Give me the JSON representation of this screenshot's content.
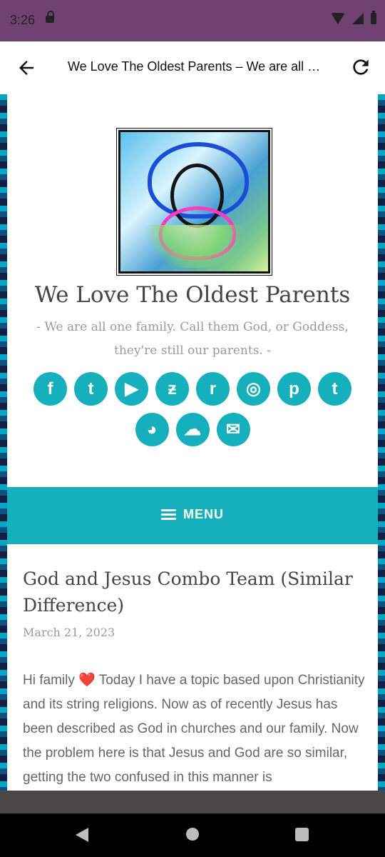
{
  "status": {
    "time": "3:26",
    "icons": [
      "lock-icon",
      "wifi-icon",
      "signal-icon",
      "battery-icon"
    ]
  },
  "appbar": {
    "title": "We Love The Oldest Parents – We are all …",
    "back_icon": "back-arrow-icon",
    "reload_icon": "reload-icon"
  },
  "site": {
    "title": "We Love The Oldest Parents",
    "tagline": "- We are all one family. Call them God, or Goddess, they're still our parents. -",
    "accent": "#16b0bc",
    "social": [
      {
        "name": "facebook",
        "glyph": "f"
      },
      {
        "name": "twitter",
        "glyph": "t"
      },
      {
        "name": "youtube",
        "glyph": "▶"
      },
      {
        "name": "deviantart",
        "glyph": "ƶ"
      },
      {
        "name": "reddit",
        "glyph": "r"
      },
      {
        "name": "instagram",
        "glyph": "◎"
      },
      {
        "name": "pinterest",
        "glyph": "p"
      },
      {
        "name": "tumblr",
        "glyph": "t"
      },
      {
        "name": "discord",
        "glyph": "◕"
      },
      {
        "name": "soundcloud",
        "glyph": "☁"
      },
      {
        "name": "email",
        "glyph": "✉"
      }
    ]
  },
  "menu": {
    "label": "MENU"
  },
  "post": {
    "title": "God and Jesus Combo Team (Similar Difference)",
    "date": "March 21, 2023",
    "body": "Hi family ❤️ Today I have a topic based upon Christianity and its string religions. Now as of recently Jesus has been described as God in churches and our family. Now the problem here is that Jesus and God are so similar, getting the two confused in this manner is"
  }
}
